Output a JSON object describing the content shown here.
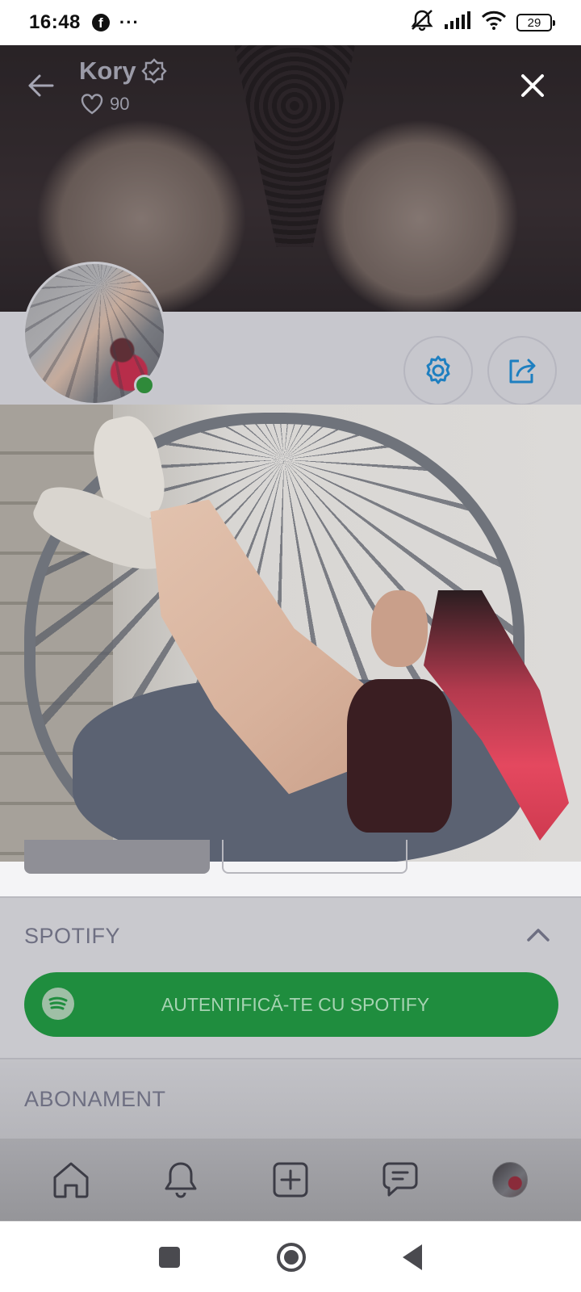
{
  "status_bar": {
    "time": "16:48",
    "fb_glyph": "f",
    "more": "···",
    "battery": "29",
    "icons": [
      "facebook-icon",
      "more-icon",
      "mute-icon",
      "signal-icon",
      "wifi-icon",
      "battery-icon"
    ]
  },
  "profile": {
    "name": "Kory",
    "likes": "90",
    "verified": true,
    "online": true,
    "online_color": "#2f8a3a"
  },
  "spotify": {
    "title": "SPOTIFY",
    "button_label": "AUTENTIFICĂ-TE CU SPOTIFY",
    "button_color": "#1f8d3e"
  },
  "subscription": {
    "title": "ABONAMENT"
  },
  "bottom_nav": {
    "items": [
      "home-icon",
      "bell-icon",
      "add-icon",
      "chat-icon",
      "avatar"
    ]
  },
  "colors": {
    "accent": "#1e7fc0",
    "overlay_text": "#6e6f82"
  }
}
